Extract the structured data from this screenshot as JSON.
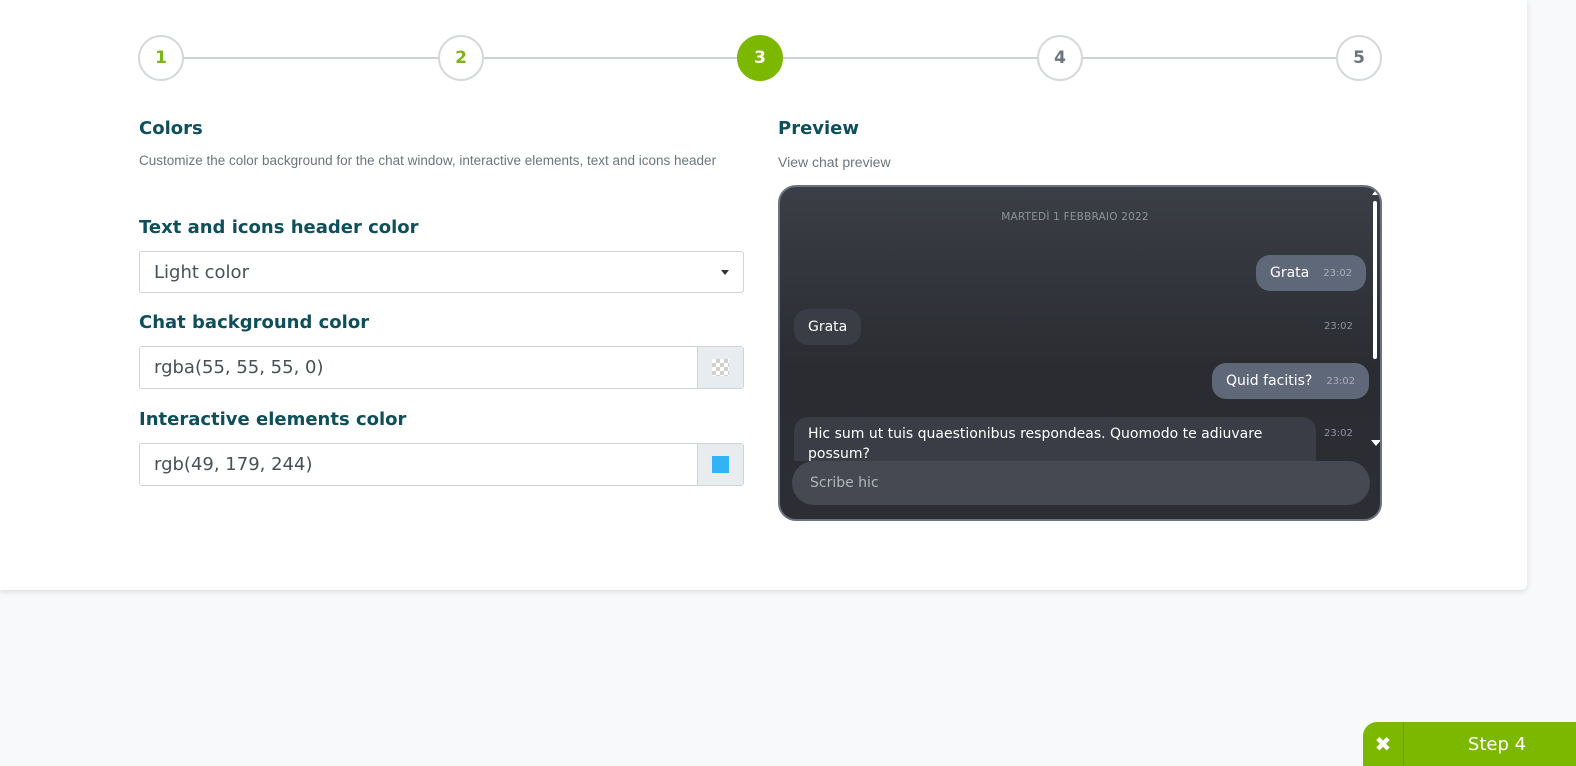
{
  "stepper": {
    "steps": [
      {
        "label": "1",
        "state": "done"
      },
      {
        "label": "2",
        "state": "done"
      },
      {
        "label": "3",
        "state": "active"
      },
      {
        "label": "4",
        "state": "pending"
      },
      {
        "label": "5",
        "state": "pending"
      }
    ]
  },
  "colors_section": {
    "title": "Colors",
    "description": "Customize the color background for the chat window, interactive elements, text and icons header",
    "header_color": {
      "label": "Text and icons header color",
      "selected": "Light color"
    },
    "chat_bg": {
      "label": "Chat background color",
      "value": "rgba(55, 55, 55, 0)"
    },
    "interactive": {
      "label": "Interactive elements color",
      "value": "rgb(49, 179, 244)",
      "swatch": "#31b3f4"
    }
  },
  "preview_section": {
    "title": "Preview",
    "description": "View chat preview",
    "chat": {
      "date": "MARTEDÌ 1 FEBBRAIO 2022",
      "messages": [
        {
          "dir": "out",
          "text": "Grata",
          "time": "23:02"
        },
        {
          "dir": "in",
          "text": "Grata",
          "time": "23:02"
        },
        {
          "dir": "out",
          "text": "Quid facitis?",
          "time": "23:02"
        },
        {
          "dir": "in",
          "text": "Hic sum ut tuis quaestionibus respondeas. Quomodo te adiuvare possum?",
          "time": "23:02"
        }
      ],
      "input_placeholder": "Scribe hic"
    }
  },
  "actions": {
    "close_icon": "✖",
    "next_label": "Step 4"
  },
  "theme": {
    "accent": "#7db800",
    "heading": "#0e4f5c"
  }
}
